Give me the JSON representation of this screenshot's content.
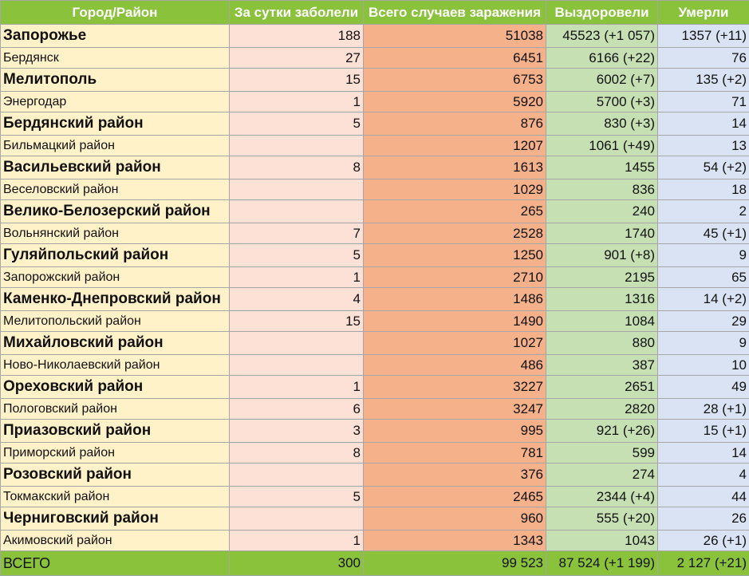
{
  "headers": [
    "Город/Район",
    "За сутки заболели",
    "Всего случаев заражения",
    "Выздоровели",
    "Умерли"
  ],
  "rows": [
    {
      "name": "Запорожье",
      "daily": "188",
      "total": "51038",
      "recovered": "45523 (+1 057)",
      "died": "1357 (+11)"
    },
    {
      "name": "Бердянск",
      "daily": "27",
      "total": "6451",
      "recovered": "6166 (+22)",
      "died": "76"
    },
    {
      "name": "Мелитополь",
      "daily": "15",
      "total": "6753",
      "recovered": "6002 (+7)",
      "died": "135 (+2)"
    },
    {
      "name": "Энергодар",
      "daily": "1",
      "total": "5920",
      "recovered": "5700 (+3)",
      "died": "71"
    },
    {
      "name": "Бердянский район",
      "daily": "5",
      "total": "876",
      "recovered": "830 (+3)",
      "died": "14"
    },
    {
      "name": "Бильмацкий район",
      "daily": "",
      "total": "1207",
      "recovered": "1061 (+49)",
      "died": "13"
    },
    {
      "name": "Васильевский район",
      "daily": "8",
      "total": "1613",
      "recovered": "1455",
      "died": "54 (+2)"
    },
    {
      "name": "Веселовский район",
      "daily": "",
      "total": "1029",
      "recovered": "836",
      "died": "18"
    },
    {
      "name": "Велико-Белозерский район",
      "daily": "",
      "total": "265",
      "recovered": "240",
      "died": "2"
    },
    {
      "name": "Вольнянский район",
      "daily": "7",
      "total": "2528",
      "recovered": "1740",
      "died": "45 (+1)"
    },
    {
      "name": "Гуляйпольский район",
      "daily": "5",
      "total": "1250",
      "recovered": "901 (+8)",
      "died": "9"
    },
    {
      "name": "Запорожский район",
      "daily": "1",
      "total": "2710",
      "recovered": "2195",
      "died": "65"
    },
    {
      "name": "Каменко-Днепровский район",
      "daily": "4",
      "total": "1486",
      "recovered": "1316",
      "died": "14 (+2)"
    },
    {
      "name": "Мелитопольский район",
      "daily": "15",
      "total": "1490",
      "recovered": "1084",
      "died": "29"
    },
    {
      "name": "Михайловский район",
      "daily": "",
      "total": "1027",
      "recovered": "880",
      "died": "9"
    },
    {
      "name": "Ново-Николаевский район",
      "daily": "",
      "total": "486",
      "recovered": "387",
      "died": "10"
    },
    {
      "name": "Ореховский район",
      "daily": "1",
      "total": "3227",
      "recovered": "2651",
      "died": "49"
    },
    {
      "name": "Пологовский район",
      "daily": "6",
      "total": "3247",
      "recovered": "2820",
      "died": "28 (+1)"
    },
    {
      "name": "Приазовский район",
      "daily": "3",
      "total": "995",
      "recovered": "921 (+26)",
      "died": "15 (+1)"
    },
    {
      "name": "Приморский район",
      "daily": "8",
      "total": "781",
      "recovered": "599",
      "died": "14"
    },
    {
      "name": "Розовский район",
      "daily": "",
      "total": "376",
      "recovered": "274",
      "died": "4"
    },
    {
      "name": "Токмакский район",
      "daily": "5",
      "total": "2465",
      "recovered": "2344 (+4)",
      "died": "44"
    },
    {
      "name": "Черниговский район",
      "daily": "",
      "total": "960",
      "recovered": "555 (+20)",
      "died": "26"
    },
    {
      "name": "Акимовский район",
      "daily": "1",
      "total": "1343",
      "recovered": "1043",
      "died": "26 (+1)"
    }
  ],
  "totals": {
    "name": "ВСЕГО",
    "daily": "300",
    "total": "99 523",
    "recovered": "87 524 (+1 199)",
    "died": "2 127 (+21)"
  },
  "colors": {
    "header_green": "#8ac23c",
    "name_col": "#fff1c8",
    "daily_col": "#fde1d6",
    "total_col": "#f4b18a",
    "recovered_col": "#c6e0b4",
    "died_col": "#dae3f3"
  }
}
